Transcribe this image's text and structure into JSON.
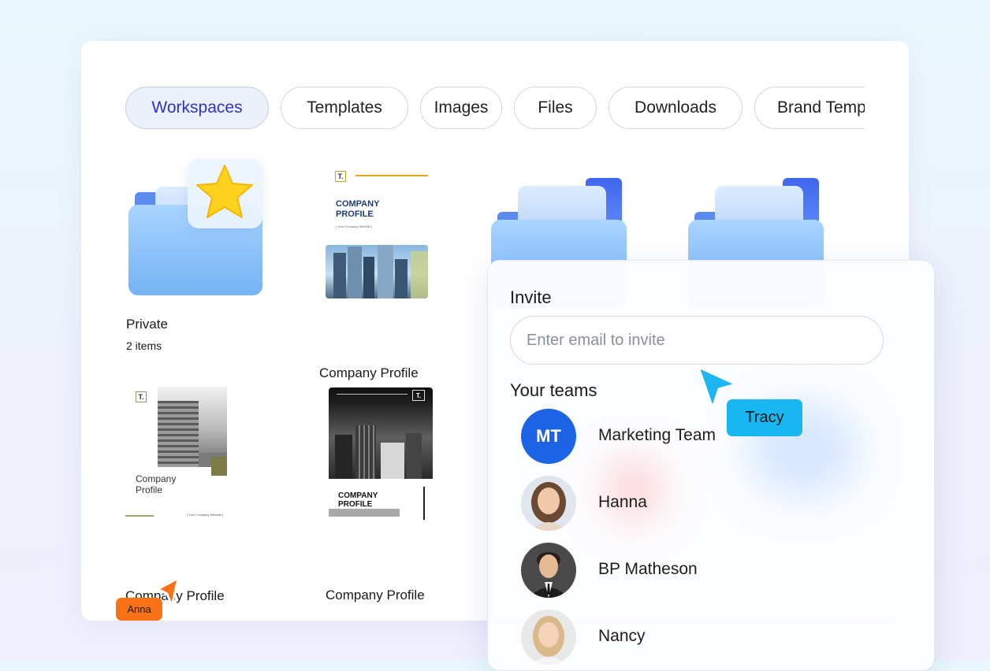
{
  "tabs": [
    {
      "label": "Workspaces",
      "active": true
    },
    {
      "label": "Templates",
      "active": false
    },
    {
      "label": "Images",
      "active": false
    },
    {
      "label": "Files",
      "active": false
    },
    {
      "label": "Downloads",
      "active": false
    },
    {
      "label": "Brand Templates",
      "active": false
    }
  ],
  "grid": {
    "private": {
      "name": "Private",
      "count": "2 items",
      "icon": "star-icon"
    },
    "doc1": {
      "name": "Company Profile",
      "heading": "COMPANY PROFILE",
      "sub": "[ Your Company Website ]",
      "logo": "T."
    },
    "doc2": {
      "name": "Company Profile",
      "heading": "Company Profile",
      "sub": "[ Your Company Website ]",
      "logo": "T."
    },
    "doc3": {
      "name": "Company Profile",
      "heading": "COMPANY PROFILE",
      "logo": "T."
    }
  },
  "invite": {
    "title": "Invite",
    "placeholder": "Enter email to invite",
    "teams_title": "Your teams",
    "members": [
      {
        "name": "Marketing Team",
        "initials": "MT"
      },
      {
        "name": "Hanna"
      },
      {
        "name": "BP Matheson"
      },
      {
        "name": "Nancy"
      }
    ]
  },
  "cursors": {
    "tracy": {
      "name": "Tracy",
      "color": "#19b7f2"
    },
    "anna": {
      "name": "Anna",
      "color": "#f97316"
    }
  },
  "colors": {
    "accent": "#2b34c9",
    "team_avatar": "#1d63e6",
    "folder": "#74b3f5"
  }
}
